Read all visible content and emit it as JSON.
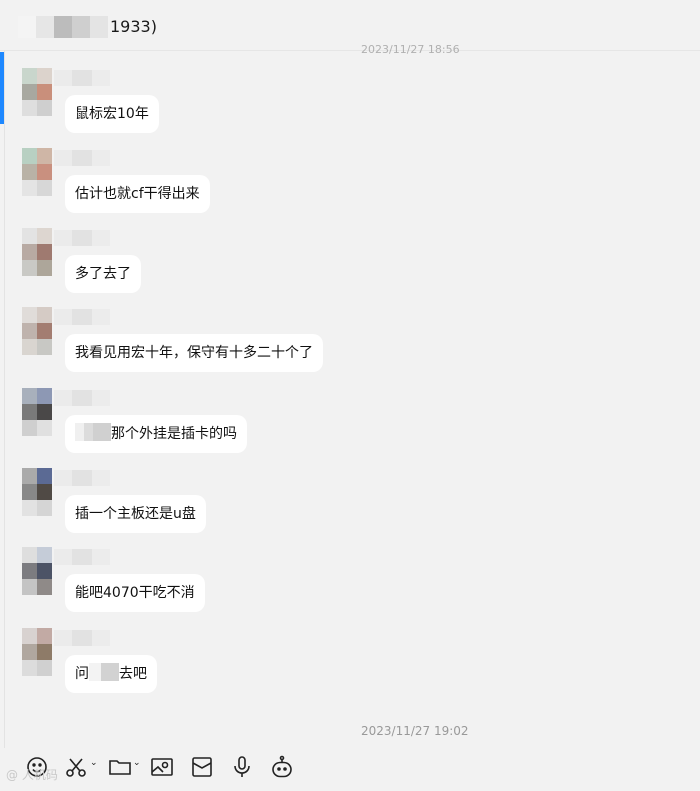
{
  "header": {
    "title_suffix": "1933)"
  },
  "timestamps": {
    "top": "2023/11/27 18:56",
    "bottom": "2023/11/27 19:02"
  },
  "messages": [
    {
      "text": "鼠标宏10年"
    },
    {
      "text": "估计也就cf干得出来"
    },
    {
      "text": "多了去了"
    },
    {
      "text": "我看见用宏十年，保守有十多二十个了"
    },
    {
      "text_after": "那个外挂是插卡的吗"
    },
    {
      "text": "插一个主板还是u盘"
    },
    {
      "text": "能吧4070干吃不消"
    },
    {
      "text_before": "问",
      "text_after": "去吧"
    }
  ],
  "toolbar": {
    "icons": [
      "emoji-icon",
      "scissors-icon",
      "folder-icon",
      "image-icon",
      "red-packet-icon",
      "microphone-icon",
      "robot-icon"
    ]
  },
  "watermark": "@ 人机码"
}
